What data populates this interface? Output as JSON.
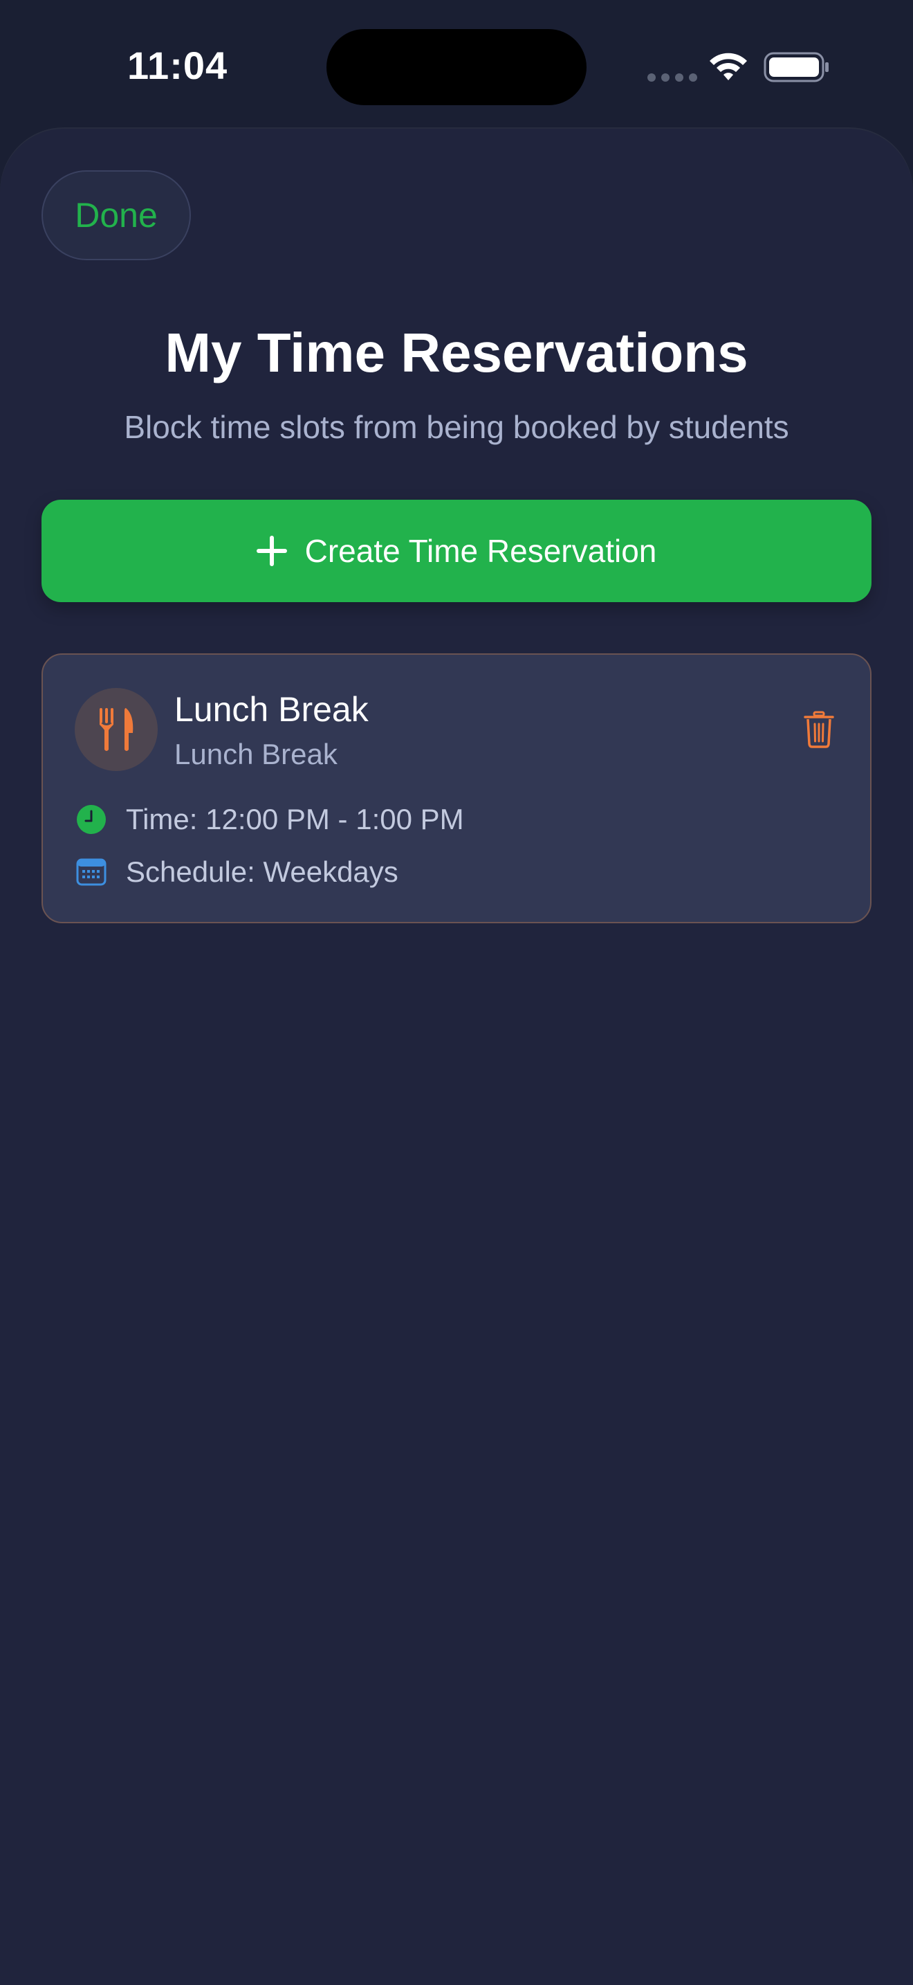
{
  "status_bar": {
    "time": "11:04"
  },
  "header": {
    "done_label": "Done",
    "title": "My Time Reservations",
    "subtitle": "Block time slots from being booked by students"
  },
  "actions": {
    "create_label": "Create Time Reservation"
  },
  "reservations": [
    {
      "title": "Lunch Break",
      "subtitle": "Lunch Break",
      "icon": "fork-knife-icon",
      "time_text": "Time: 12:00 PM - 1:00 PM",
      "schedule_text": "Schedule: Weekdays"
    }
  ],
  "colors": {
    "accent_green": "#22b24c",
    "accent_orange": "#f07a3a",
    "calendar_blue": "#3d8fe0",
    "background": "#20243d",
    "card": "#323854"
  }
}
